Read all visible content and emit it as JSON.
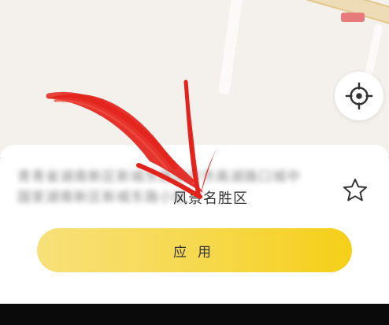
{
  "location": {
    "address_lines": [
      "青青省湖南新区新城东路南京市高湖路口城中",
      "国家湖南新区新城东路小区"
    ],
    "place_name": "风景名胜区"
  },
  "actions": {
    "apply_label": "应用"
  },
  "icons": {
    "locate": "crosshair-icon",
    "favorite": "star-outline-icon"
  },
  "colors": {
    "accent_start": "#f8e07a",
    "accent_end": "#f5cf18",
    "annotation_arrow": "#e3231b",
    "map_background": "#f4f1ed"
  }
}
